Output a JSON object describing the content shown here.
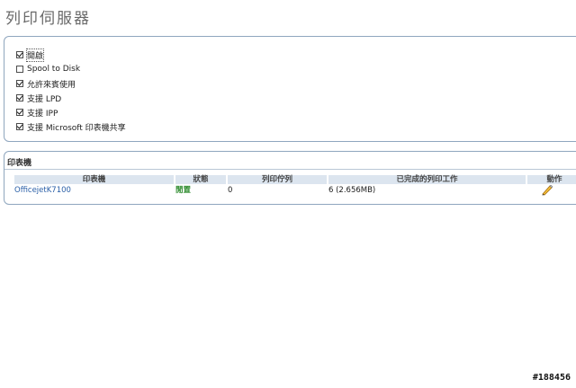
{
  "page": {
    "title": "列印伺服器"
  },
  "settings": {
    "options": [
      {
        "label": "開啟",
        "checked": true
      },
      {
        "label": "Spool to Disk",
        "checked": false
      },
      {
        "label": "允許來賓使用",
        "checked": true
      },
      {
        "label": "支援 LPD",
        "checked": true
      },
      {
        "label": "支援 IPP",
        "checked": true
      },
      {
        "label": "支援 Microsoft 印表機共享",
        "checked": true
      }
    ]
  },
  "printers": {
    "title": "印表機",
    "columns": [
      "印表機",
      "狀態",
      "列印佇列",
      "已完成的列印工作",
      "動作"
    ],
    "rows": [
      {
        "name": "OfficejetK7100",
        "status": "閒置",
        "queue": "0",
        "completed": "6 (2.656MB)",
        "action_icon": "pencil-icon"
      }
    ]
  },
  "watermark": "#188456"
}
